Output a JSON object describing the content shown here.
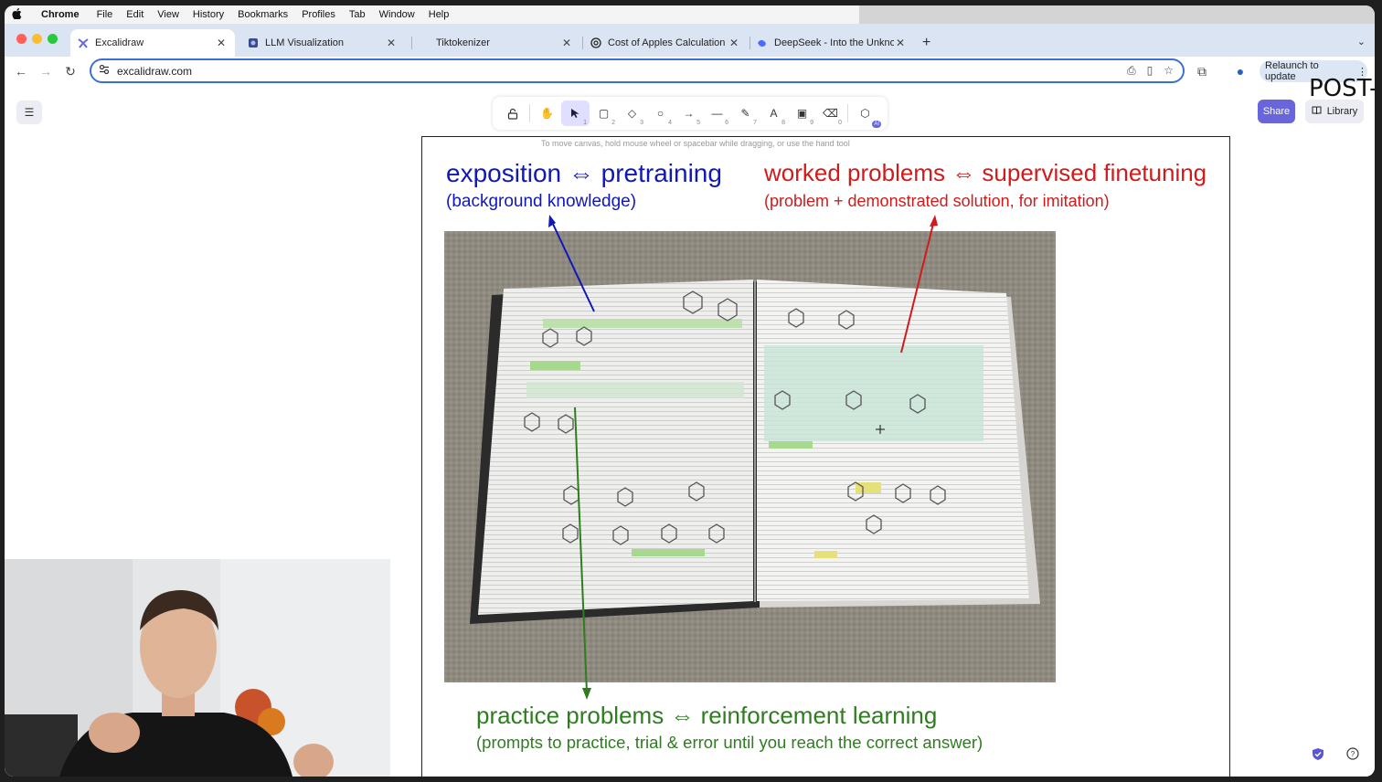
{
  "menubar": {
    "app": "Chrome",
    "items": [
      "File",
      "Edit",
      "View",
      "History",
      "Bookmarks",
      "Profiles",
      "Tab",
      "Window",
      "Help"
    ]
  },
  "tabs": [
    {
      "title": "Excalidraw",
      "icon": "excalidraw-icon",
      "active": true
    },
    {
      "title": "LLM Visualization",
      "icon": "llm-viz-icon",
      "active": false
    },
    {
      "title": "Tiktokenizer",
      "icon": "",
      "active": false
    },
    {
      "title": "Cost of Apples Calculation",
      "icon": "openai-icon",
      "active": false
    },
    {
      "title": "DeepSeek - Into the Unknown",
      "icon": "deepseek-icon",
      "active": false
    }
  ],
  "address": {
    "url": "excalidraw.com"
  },
  "relaunch_label": "Relaunch to update",
  "excalidraw": {
    "share_label": "Share",
    "library_label": "Library",
    "hint": "To move canvas, hold mouse wheel or spacebar while dragging, or use the hand tool",
    "partial_heading": "POST-",
    "tools": [
      {
        "name": "lock-icon",
        "glyph": "🔓",
        "key": ""
      },
      {
        "name": "hand-icon",
        "glyph": "✋",
        "key": ""
      },
      {
        "name": "selection-icon",
        "glyph": "➚",
        "key": "1"
      },
      {
        "name": "rectangle-icon",
        "glyph": "▢",
        "key": "2"
      },
      {
        "name": "diamond-icon",
        "glyph": "◇",
        "key": "3"
      },
      {
        "name": "ellipse-icon",
        "glyph": "○",
        "key": "4"
      },
      {
        "name": "arrow-icon",
        "glyph": "→",
        "key": "5"
      },
      {
        "name": "line-icon",
        "glyph": "—",
        "key": "6"
      },
      {
        "name": "pencil-icon",
        "glyph": "✎",
        "key": "7"
      },
      {
        "name": "text-icon",
        "glyph": "A",
        "key": "8"
      },
      {
        "name": "image-icon",
        "glyph": "▣",
        "key": "9"
      },
      {
        "name": "eraser-icon",
        "glyph": "⌫",
        "key": "0"
      },
      {
        "name": "extra-tools-icon",
        "glyph": "⬡",
        "key": ""
      }
    ],
    "ai_badge": "AI"
  },
  "slide": {
    "blue_title": "exposition ⇔ pretraining",
    "blue_sub": "(background knowledge)",
    "red_title": "worked problems ⇔ supervised finetuning",
    "red_sub": "(problem + demonstrated solution, for imitation)",
    "green_title": "practice problems ⇔ reinforcement learning",
    "green_sub": "(prompts to practice, trial & error until you reach the correct answer)",
    "colors": {
      "blue": "#1018b8",
      "red": "#cf1b1b",
      "green": "#2e7d1f"
    }
  }
}
